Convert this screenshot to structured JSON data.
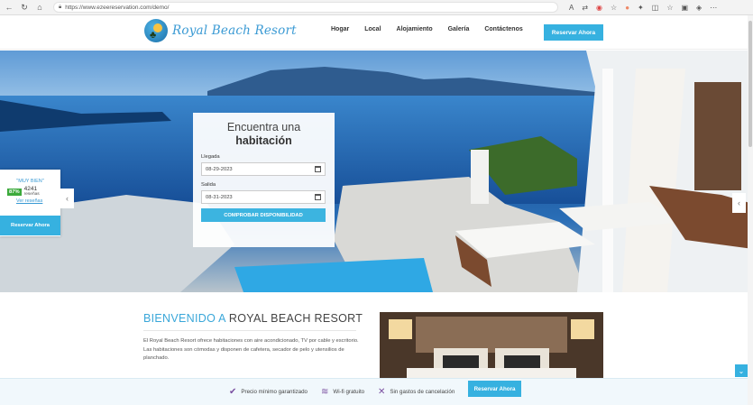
{
  "browser": {
    "url": "https://www.ezeereservation.com/demo/",
    "icons": [
      "back-icon",
      "refresh-icon",
      "home-icon",
      "read-aloud-icon",
      "translate-icon",
      "extension-icon",
      "favorite-icon",
      "profile-icon",
      "puzzle-icon",
      "split-screen-icon",
      "favorites-icon",
      "collections-icon",
      "extensions-shield-icon",
      "menu-icon"
    ]
  },
  "header": {
    "logo_text": "Royal Beach Resort",
    "menu": [
      "Hogar",
      "Local",
      "Alojamiento",
      "Galería",
      "Contáctenos"
    ],
    "cta": "Reservar Ahora",
    "accent_color": "#36b1e0"
  },
  "search": {
    "title_line1": "Encuentra una",
    "title_line2": "habitación",
    "checkin_label": "Llegada",
    "checkin_value": "08-29-2023",
    "checkout_label": "Salida",
    "checkout_value": "08-31-2023",
    "button": "COMPROBAR DISPONIBILIDAD"
  },
  "review": {
    "rating_text": "\"MUY BIEN\"",
    "percent": "87%",
    "count": "4241",
    "count_label": "reseñas",
    "link": "Ver reseñas",
    "cta": "Reservar Ahora"
  },
  "welcome": {
    "title_accent": "BIENVENIDO A",
    "title_rest": "ROYAL BEACH RESORT",
    "body": "El Royal Beach Resort ofrece habitaciones con aire acondicionado, TV por cable y escritorio. Las habitaciones son cómodas y disponen de cafetera, secador de pelo y utensilios de planchado."
  },
  "bottom_bar": {
    "features": [
      "Precio mínimo garantizado",
      "Wi-fi gratuito",
      "Sin gastos de cancelación"
    ],
    "cta": "Reservar Ahora"
  }
}
